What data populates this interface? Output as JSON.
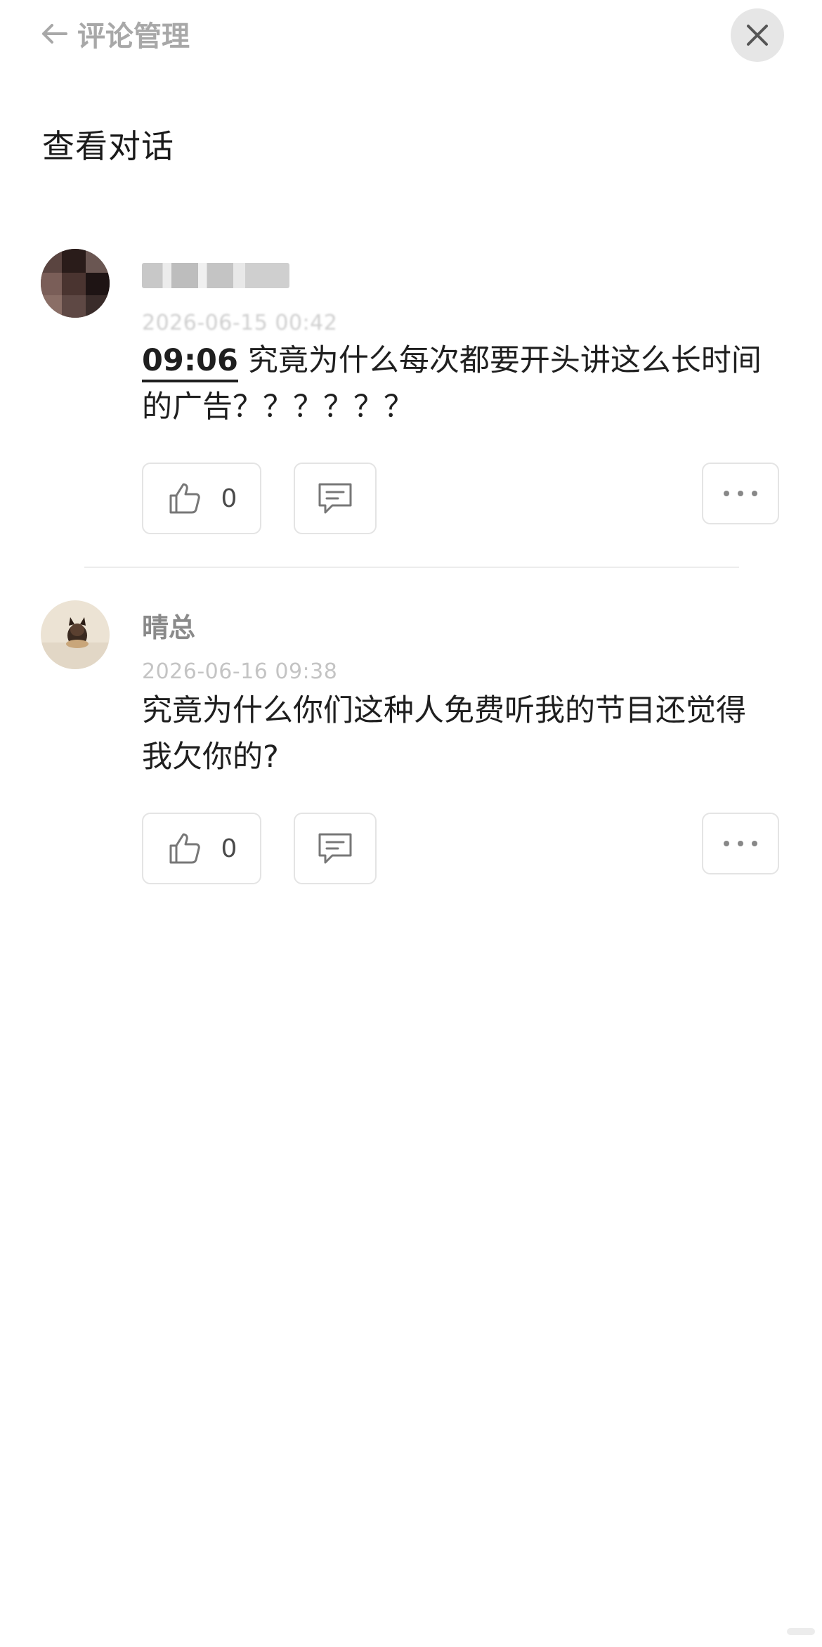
{
  "header": {
    "back_label": "评论管理",
    "close_icon": "close-icon"
  },
  "page_title": "查看对话",
  "comments": [
    {
      "username": "",
      "timestamp": "2026-06-15 00:42",
      "time_link": "09:06",
      "text": "究竟为什么每次都要开头讲这么长时间的广告？？？？？？",
      "like_count": "0"
    },
    {
      "username": "晴总",
      "timestamp": "2026-06-16 09:38",
      "time_link": "",
      "text": "究竟为什么你们这种人免费听我的节目还觉得我欠你的?",
      "like_count": "0"
    }
  ],
  "colors": {
    "muted_text": "#8a8a8a",
    "timestamp": "#c4c4c4",
    "border": "#e4e4e4",
    "close_bg": "#e6e6e6"
  }
}
